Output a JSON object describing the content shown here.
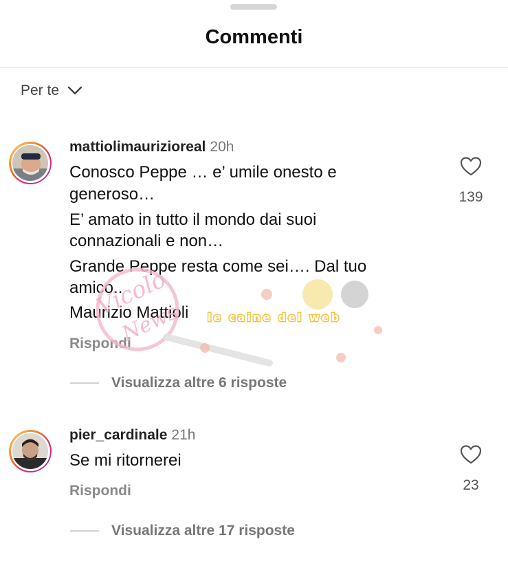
{
  "header": {
    "title": "Commenti"
  },
  "filter": {
    "label": "Per te"
  },
  "comments": [
    {
      "username": "mattiolimaurizioreal",
      "time": "20h",
      "lines": [
        "Conosco Peppe … e’ umile onesto e",
        "generoso…",
        "E’ amato in tutto il mondo dai suoi",
        "connazionali e non…",
        "Grande Peppe resta come sei…. Dal tuo",
        "amico..",
        "Maurizio Mattioli"
      ],
      "reply_label": "Rispondi",
      "likes": "139",
      "view_replies": "Visualizza altre 6 risposte"
    },
    {
      "username": "pier_cardinale",
      "time": "21h",
      "lines": [
        "Se mi ritornerei"
      ],
      "reply_label": "Rispondi",
      "likes": "23",
      "view_replies": "Visualizza altre 17 risposte"
    }
  ],
  "watermark": {
    "logo_text": "Vicolo News",
    "banner_text": "le caine del web"
  },
  "colors": {
    "accent_gradient": [
      "#feda75",
      "#fa7e1e",
      "#d62976",
      "#962fbf"
    ]
  }
}
